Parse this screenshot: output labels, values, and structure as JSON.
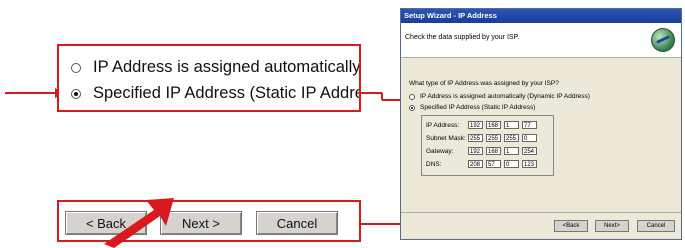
{
  "zoom": {
    "radio_dynamic_label": "IP Address is assigned automatically (Dyna",
    "radio_static_label": "Specified IP Address (Static IP Address)",
    "back_label": "< Back",
    "next_label": "Next >",
    "cancel_label": "Cancel"
  },
  "dialog": {
    "title": "Setup Wizard - IP Address",
    "header_text": "Check the data supplied by your ISP.",
    "question": "What type of IP Address was assigned by your ISP?",
    "radio_dynamic_label": "IP Address is assigned automatically (Dynamic IP Address)",
    "radio_static_label": "Specified IP Address (Static IP Address)",
    "fields": [
      {
        "label": "IP Address:",
        "octets": [
          "192",
          "168",
          "1",
          "77"
        ]
      },
      {
        "label": "Subnet Mask:",
        "octets": [
          "255",
          "255",
          "255",
          "0"
        ]
      },
      {
        "label": "Gateway:",
        "octets": [
          "192",
          "168",
          "1",
          "254"
        ]
      },
      {
        "label": "DNS:",
        "octets": [
          "208",
          "57",
          "0",
          "123"
        ]
      }
    ],
    "back_label": "<Back",
    "next_label": "Next>",
    "cancel_label": "Cancel"
  },
  "colors": {
    "callout_red": "#d8191f",
    "title_blue": "#1a3c9a"
  }
}
